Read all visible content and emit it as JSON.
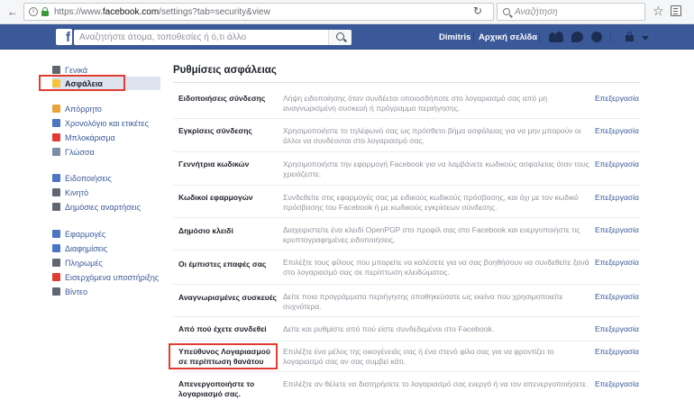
{
  "browser": {
    "url_prefix": "https://www.",
    "url_host": "facebook.com",
    "url_path": "/settings?tab=security&view",
    "search_placeholder": "Αναζήτηση",
    "back_glyph": "←"
  },
  "fb_header": {
    "logo": "f",
    "search_placeholder": "Αναζητήστε άτομα, τοποθεσίες ή ό,τι άλλο",
    "user_name": "Dimitris",
    "home_label": "Αρχική σελίδα"
  },
  "sidebar": {
    "items": [
      {
        "label": "Γενικά",
        "icon": "gear-icon",
        "color": "#606770"
      },
      {
        "label": "Ασφάλεια",
        "icon": "shield-icon",
        "color": "#f5c33b"
      },
      {
        "label": "Απόρρητο",
        "icon": "lock-icon",
        "color": "#e8a33c"
      },
      {
        "label": "Χρονολόγιο και ετικέτες",
        "icon": "timeline-icon",
        "color": "#4a76c4"
      },
      {
        "label": "Μπλοκάρισμα",
        "icon": "block-icon",
        "color": "#e03c31"
      },
      {
        "label": "Γλώσσα",
        "icon": "language-icon",
        "color": "#7a8ca8"
      },
      {
        "label": "Ειδοποιήσεις",
        "icon": "globe-icon",
        "color": "#4a76c4"
      },
      {
        "label": "Κινητό",
        "icon": "mobile-icon",
        "color": "#606770"
      },
      {
        "label": "Δημόσιες αναρτήσεις",
        "icon": "rss-icon",
        "color": "#606770"
      },
      {
        "label": "Εφαρμογές",
        "icon": "apps-icon",
        "color": "#4a76c4"
      },
      {
        "label": "Διαφημίσεις",
        "icon": "ads-icon",
        "color": "#4a76c4"
      },
      {
        "label": "Πληρωμές",
        "icon": "payments-icon",
        "color": "#606770"
      },
      {
        "label": "Εισερχόμενα υποστήριξης",
        "icon": "support-icon",
        "color": "#e03c31"
      },
      {
        "label": "Βίντεο",
        "icon": "video-icon",
        "color": "#606770"
      }
    ]
  },
  "main": {
    "title": "Ρυθμίσεις ασφάλειας",
    "edit_label": "Επεξεργασία",
    "rows": [
      {
        "label": "Ειδοποιήσεις σύνδεσης",
        "desc": "Λήψη ειδοποίησης όταν συνδέεται οποιοσδήποτε στο λογαριασμό σας από μη αναγνωρισμένη συσκευή ή πρόγραμμα περιήγησης."
      },
      {
        "label": "Εγκρίσεις σύνδεσης",
        "desc": "Χρησιμοποιήστε το τηλέφωνό σας ως πρόσθετο βήμα ασφάλειας για να μην μπορούν οι άλλοι να συνδέονται στο λογαριασμό σας."
      },
      {
        "label": "Γεννήτρια κωδικών",
        "desc": "Χρησιμοποιήστε την εφαρμογή Facebook για να λαμβάνετε κωδικούς ασφαλείας όταν τους χρειάζεστε."
      },
      {
        "label": "Κωδικοί εφαρμογών",
        "desc": "Συνδεθείτε στις εφαρμογές σας με ειδικούς κωδικούς πρόσβασης, και όχι με τον κωδικό πρόσβασης του Facebook ή με κωδικούς εγκρίσεων σύνδεσης."
      },
      {
        "label": "Δημόσιο κλειδί",
        "desc": "Διαχειριστείτε ένα κλειδί OpenPGP στο προφίλ σας στο Facebook και ενεργοποιήστε τις κρυπτογραφημένες ειδοποιήσεις."
      },
      {
        "label": "Οι έμπιστες επαφές σας",
        "desc": "Επιλέξτε τους φίλους που μπορείτε να καλέσετε για να σας βοηθήσουν να συνδεθείτε ξανά στο λογαριασμό σας σε περίπτωση κλειδώματος."
      },
      {
        "label": "Αναγνωρισμένες συσκευές",
        "desc": "Δείτε ποια προγράμματα περιήγησης αποθηκεύσατε ως εκείνα που χρησιμοποιείτε συχνότερα."
      },
      {
        "label": "Από πού έχετε συνδεθεί",
        "desc": "Δείτε και ρυθμίστε από πού είστε συνδεδεμένοι στο Facebook."
      },
      {
        "label": "Υπεύθυνος Λογαριασμού σε περίπτωση θανάτου",
        "desc": "Επιλέξτε ένα μέλος της οικογένειάς σας ή ένα στενό φίλο σας για να φροντίζει το λογαριασμό σας αν σας συμβεί κάτι."
      },
      {
        "label": "Απενεργοποιήστε το λογαριασμό σας.",
        "desc": "Επιλέξτε αν θέλετε να διατηρήσετε το λογαριασμό σας ενεργό ή να τον απενεργοποιήσετε."
      }
    ]
  },
  "colors": {
    "fb_blue": "#3b5998",
    "link_blue": "#365899",
    "highlight_red": "#e03c31",
    "selected_bg": "#dde4f0"
  }
}
